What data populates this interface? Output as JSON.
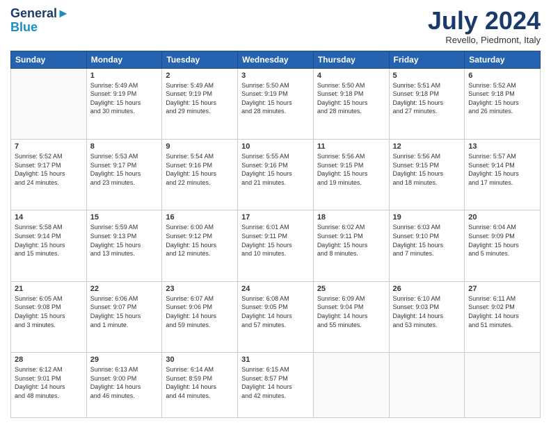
{
  "header": {
    "logo_line1": "General",
    "logo_line2": "Blue",
    "month": "July 2024",
    "location": "Revello, Piedmont, Italy"
  },
  "weekdays": [
    "Sunday",
    "Monday",
    "Tuesday",
    "Wednesday",
    "Thursday",
    "Friday",
    "Saturday"
  ],
  "weeks": [
    [
      {
        "day": "",
        "info": ""
      },
      {
        "day": "1",
        "info": "Sunrise: 5:49 AM\nSunset: 9:19 PM\nDaylight: 15 hours\nand 30 minutes."
      },
      {
        "day": "2",
        "info": "Sunrise: 5:49 AM\nSunset: 9:19 PM\nDaylight: 15 hours\nand 29 minutes."
      },
      {
        "day": "3",
        "info": "Sunrise: 5:50 AM\nSunset: 9:19 PM\nDaylight: 15 hours\nand 28 minutes."
      },
      {
        "day": "4",
        "info": "Sunrise: 5:50 AM\nSunset: 9:18 PM\nDaylight: 15 hours\nand 28 minutes."
      },
      {
        "day": "5",
        "info": "Sunrise: 5:51 AM\nSunset: 9:18 PM\nDaylight: 15 hours\nand 27 minutes."
      },
      {
        "day": "6",
        "info": "Sunrise: 5:52 AM\nSunset: 9:18 PM\nDaylight: 15 hours\nand 26 minutes."
      }
    ],
    [
      {
        "day": "7",
        "info": "Sunrise: 5:52 AM\nSunset: 9:17 PM\nDaylight: 15 hours\nand 24 minutes."
      },
      {
        "day": "8",
        "info": "Sunrise: 5:53 AM\nSunset: 9:17 PM\nDaylight: 15 hours\nand 23 minutes."
      },
      {
        "day": "9",
        "info": "Sunrise: 5:54 AM\nSunset: 9:16 PM\nDaylight: 15 hours\nand 22 minutes."
      },
      {
        "day": "10",
        "info": "Sunrise: 5:55 AM\nSunset: 9:16 PM\nDaylight: 15 hours\nand 21 minutes."
      },
      {
        "day": "11",
        "info": "Sunrise: 5:56 AM\nSunset: 9:15 PM\nDaylight: 15 hours\nand 19 minutes."
      },
      {
        "day": "12",
        "info": "Sunrise: 5:56 AM\nSunset: 9:15 PM\nDaylight: 15 hours\nand 18 minutes."
      },
      {
        "day": "13",
        "info": "Sunrise: 5:57 AM\nSunset: 9:14 PM\nDaylight: 15 hours\nand 17 minutes."
      }
    ],
    [
      {
        "day": "14",
        "info": "Sunrise: 5:58 AM\nSunset: 9:14 PM\nDaylight: 15 hours\nand 15 minutes."
      },
      {
        "day": "15",
        "info": "Sunrise: 5:59 AM\nSunset: 9:13 PM\nDaylight: 15 hours\nand 13 minutes."
      },
      {
        "day": "16",
        "info": "Sunrise: 6:00 AM\nSunset: 9:12 PM\nDaylight: 15 hours\nand 12 minutes."
      },
      {
        "day": "17",
        "info": "Sunrise: 6:01 AM\nSunset: 9:11 PM\nDaylight: 15 hours\nand 10 minutes."
      },
      {
        "day": "18",
        "info": "Sunrise: 6:02 AM\nSunset: 9:11 PM\nDaylight: 15 hours\nand 8 minutes."
      },
      {
        "day": "19",
        "info": "Sunrise: 6:03 AM\nSunset: 9:10 PM\nDaylight: 15 hours\nand 7 minutes."
      },
      {
        "day": "20",
        "info": "Sunrise: 6:04 AM\nSunset: 9:09 PM\nDaylight: 15 hours\nand 5 minutes."
      }
    ],
    [
      {
        "day": "21",
        "info": "Sunrise: 6:05 AM\nSunset: 9:08 PM\nDaylight: 15 hours\nand 3 minutes."
      },
      {
        "day": "22",
        "info": "Sunrise: 6:06 AM\nSunset: 9:07 PM\nDaylight: 15 hours\nand 1 minute."
      },
      {
        "day": "23",
        "info": "Sunrise: 6:07 AM\nSunset: 9:06 PM\nDaylight: 14 hours\nand 59 minutes."
      },
      {
        "day": "24",
        "info": "Sunrise: 6:08 AM\nSunset: 9:05 PM\nDaylight: 14 hours\nand 57 minutes."
      },
      {
        "day": "25",
        "info": "Sunrise: 6:09 AM\nSunset: 9:04 PM\nDaylight: 14 hours\nand 55 minutes."
      },
      {
        "day": "26",
        "info": "Sunrise: 6:10 AM\nSunset: 9:03 PM\nDaylight: 14 hours\nand 53 minutes."
      },
      {
        "day": "27",
        "info": "Sunrise: 6:11 AM\nSunset: 9:02 PM\nDaylight: 14 hours\nand 51 minutes."
      }
    ],
    [
      {
        "day": "28",
        "info": "Sunrise: 6:12 AM\nSunset: 9:01 PM\nDaylight: 14 hours\nand 48 minutes."
      },
      {
        "day": "29",
        "info": "Sunrise: 6:13 AM\nSunset: 9:00 PM\nDaylight: 14 hours\nand 46 minutes."
      },
      {
        "day": "30",
        "info": "Sunrise: 6:14 AM\nSunset: 8:59 PM\nDaylight: 14 hours\nand 44 minutes."
      },
      {
        "day": "31",
        "info": "Sunrise: 6:15 AM\nSunset: 8:57 PM\nDaylight: 14 hours\nand 42 minutes."
      },
      {
        "day": "",
        "info": ""
      },
      {
        "day": "",
        "info": ""
      },
      {
        "day": "",
        "info": ""
      }
    ]
  ]
}
